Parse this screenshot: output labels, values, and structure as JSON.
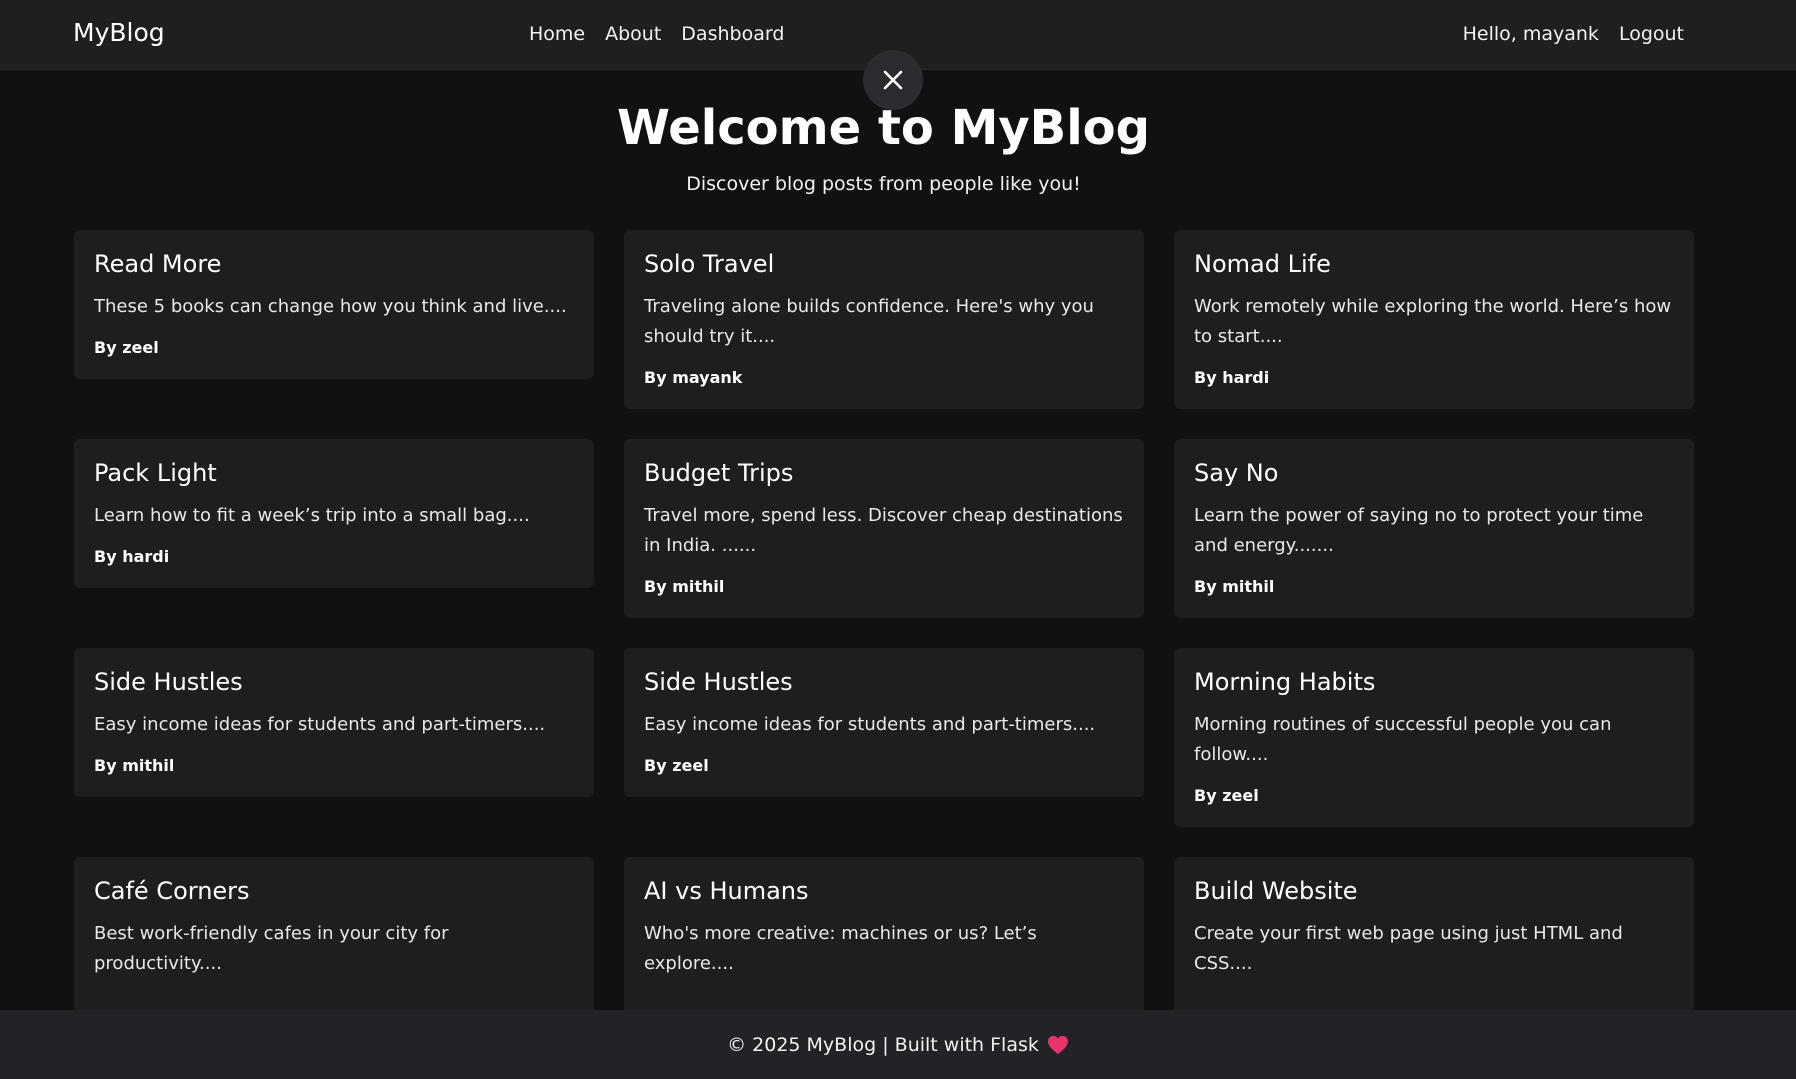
{
  "navbar": {
    "brand": "MyBlog",
    "links": [
      "Home",
      "About",
      "Dashboard"
    ],
    "greeting": "Hello, mayank",
    "logout": "Logout"
  },
  "hero": {
    "title": "Welcome to MyBlog",
    "subtitle": "Discover blog posts from people like you!"
  },
  "posts": [
    {
      "title": "Read More",
      "excerpt": "These 5 books can change how you think and live....",
      "author": "By zeel"
    },
    {
      "title": "Solo Travel",
      "excerpt": "Traveling alone builds confidence. Here's why you should try it....",
      "author": "By mayank"
    },
    {
      "title": "Nomad Life",
      "excerpt": "Work remotely while exploring the world. Here’s how to start....",
      "author": "By hardi"
    },
    {
      "title": "Pack Light",
      "excerpt": "Learn how to fit a week’s trip into a small bag....",
      "author": "By hardi"
    },
    {
      "title": "Budget Trips",
      "excerpt": "Travel more, spend less. Discover cheap destinations in India. ......",
      "author": "By mithil"
    },
    {
      "title": "Say No",
      "excerpt": "Learn the power of saying no to protect your time and energy.......",
      "author": "By mithil"
    },
    {
      "title": "Side Hustles",
      "excerpt": "Easy income ideas for students and part-timers....",
      "author": "By mithil"
    },
    {
      "title": "Side Hustles",
      "excerpt": "Easy income ideas for students and part-timers....",
      "author": "By zeel"
    },
    {
      "title": "Morning Habits",
      "excerpt": "Morning routines of successful people you can follow....",
      "author": "By zeel"
    },
    {
      "title": "Café Corners",
      "excerpt": "Best work-friendly cafes in your city for productivity....",
      "author": ""
    },
    {
      "title": "AI vs Humans",
      "excerpt": "Who's more creative: machines or us? Let’s explore....",
      "author": ""
    },
    {
      "title": "Build Website",
      "excerpt": "Create your first web page using just HTML and CSS....",
      "author": ""
    }
  ],
  "footer": {
    "text": "© 2025 MyBlog | Built with Flask",
    "icon": "heart-icon",
    "heart_color": "#e8336b"
  },
  "colors": {
    "background": "#111111",
    "navbar": "#1f1f21",
    "card": "#1e1e20",
    "footer": "#212327"
  }
}
